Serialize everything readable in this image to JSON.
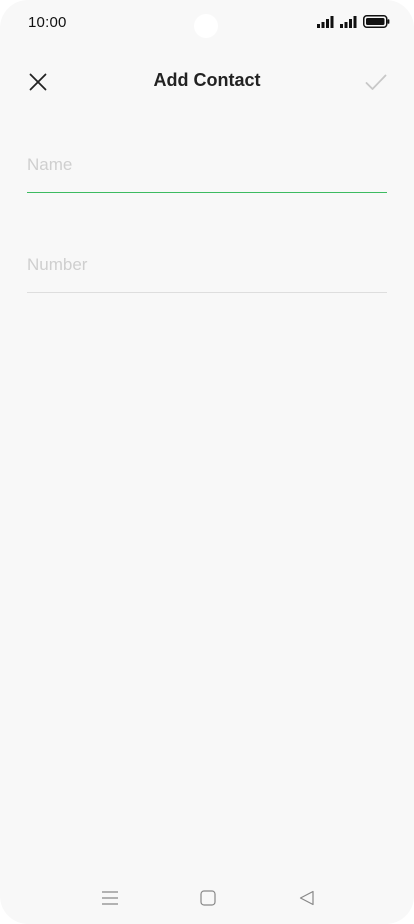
{
  "status_bar": {
    "time": "10:00",
    "icons": [
      "cellular-signal-1-icon",
      "cellular-signal-2-icon",
      "battery-icon"
    ]
  },
  "app_bar": {
    "title": "Add Contact",
    "close_icon": "close-icon",
    "confirm_icon": "checkmark-icon"
  },
  "form": {
    "name": {
      "placeholder": "Name",
      "value": "",
      "focused": true
    },
    "number": {
      "placeholder": "Number",
      "value": "",
      "focused": false
    }
  },
  "nav_bar": {
    "icons": [
      "menu-icon",
      "home-icon",
      "back-icon"
    ]
  },
  "colors": {
    "background": "#f8f8f8",
    "accent_underline": "#3dbb61",
    "placeholder": "#cfcfcf",
    "divider": "#dedede",
    "confirm_disabled": "#c8c8c8"
  }
}
